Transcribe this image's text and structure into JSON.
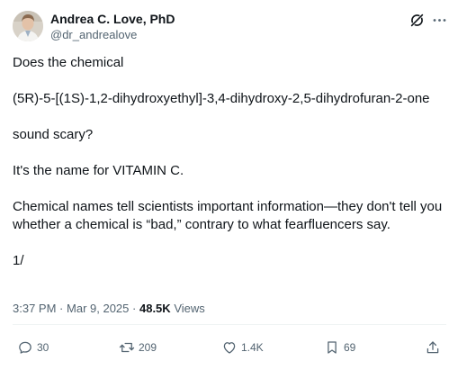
{
  "author": {
    "display_name": "Andrea C. Love, PhD",
    "handle": "@dr_andrealove"
  },
  "icons": {
    "grok": "grok-icon",
    "more": "more-icon",
    "reply": "reply-icon",
    "retweet": "retweet-icon",
    "like": "heart-icon",
    "bookmark": "bookmark-icon",
    "share": "share-icon"
  },
  "post": {
    "paragraphs": [
      "Does the chemical",
      "(5R)-5-[(1S)-1,2-dihydroxyethyl]-3,4-dihydroxy-2,5-dihydrofuran-2-one",
      "sound scary?",
      "It's the name for VITAMIN C.",
      "Chemical names tell scientists important information—they don't tell you whether a chemical is “bad,” contrary to what fearfluencers say.",
      "1/"
    ]
  },
  "meta": {
    "time": "3:37 PM",
    "separator": "·",
    "date": "Mar 9, 2025",
    "views_count": "48.5K",
    "views_label": "Views"
  },
  "actions": {
    "reply_count": "30",
    "retweet_count": "209",
    "like_count": "1.4K",
    "bookmark_count": "69"
  },
  "colors": {
    "text": "#0f1419",
    "secondary": "#536471",
    "divider": "#eff3f4"
  }
}
